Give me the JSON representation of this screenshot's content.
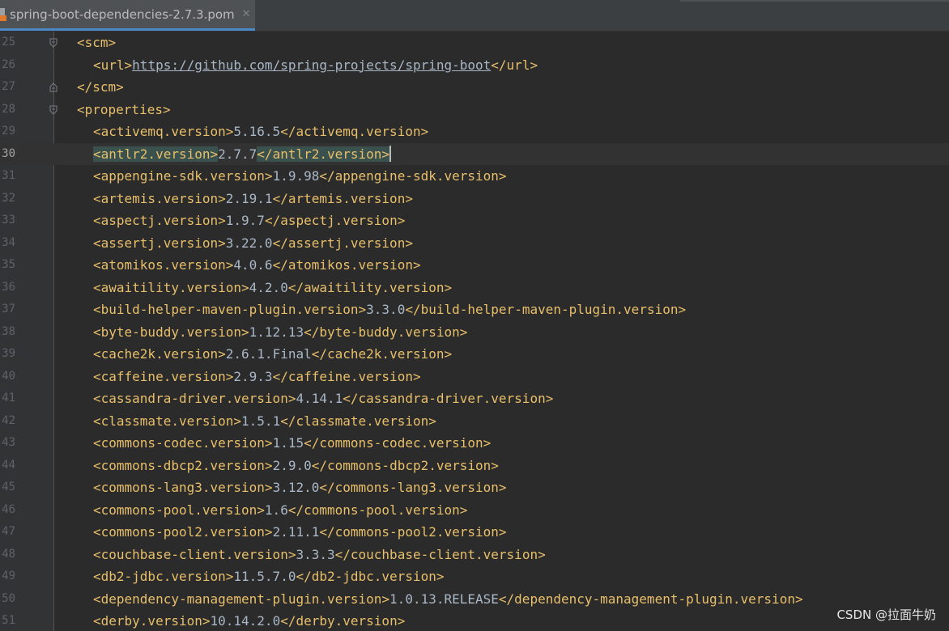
{
  "tab": {
    "title": "spring-boot-dependencies-2.7.3.pom",
    "close_glyph": "✕",
    "icon": "maven-pom-file-icon"
  },
  "editor": {
    "lines": [
      {
        "n": "25",
        "indent": 1,
        "open": "<scm>",
        "value": "",
        "close": "",
        "fold": "open"
      },
      {
        "n": "26",
        "indent": 2,
        "open": "<url>",
        "value": "https://github.com/spring-projects/spring-boot",
        "close": "</url>",
        "url": true
      },
      {
        "n": "27",
        "indent": 1,
        "open": "</scm>",
        "value": "",
        "close": "",
        "fold": "close"
      },
      {
        "n": "28",
        "indent": 1,
        "open": "<properties>",
        "value": "",
        "close": "",
        "fold": "open"
      },
      {
        "n": "29",
        "indent": 2,
        "open": "<activemq.version>",
        "value": "5.16.5",
        "close": "</activemq.version>"
      },
      {
        "n": "30",
        "indent": 2,
        "open": "<antlr2.version>",
        "value": "2.7.7",
        "close": "</antlr2.version>",
        "current": true
      },
      {
        "n": "31",
        "indent": 2,
        "open": "<appengine-sdk.version>",
        "value": "1.9.98",
        "close": "</appengine-sdk.version>"
      },
      {
        "n": "32",
        "indent": 2,
        "open": "<artemis.version>",
        "value": "2.19.1",
        "close": "</artemis.version>"
      },
      {
        "n": "33",
        "indent": 2,
        "open": "<aspectj.version>",
        "value": "1.9.7",
        "close": "</aspectj.version>"
      },
      {
        "n": "34",
        "indent": 2,
        "open": "<assertj.version>",
        "value": "3.22.0",
        "close": "</assertj.version>"
      },
      {
        "n": "35",
        "indent": 2,
        "open": "<atomikos.version>",
        "value": "4.0.6",
        "close": "</atomikos.version>"
      },
      {
        "n": "36",
        "indent": 2,
        "open": "<awaitility.version>",
        "value": "4.2.0",
        "close": "</awaitility.version>"
      },
      {
        "n": "37",
        "indent": 2,
        "open": "<build-helper-maven-plugin.version>",
        "value": "3.3.0",
        "close": "</build-helper-maven-plugin.version>"
      },
      {
        "n": "38",
        "indent": 2,
        "open": "<byte-buddy.version>",
        "value": "1.12.13",
        "close": "</byte-buddy.version>"
      },
      {
        "n": "39",
        "indent": 2,
        "open": "<cache2k.version>",
        "value": "2.6.1.Final",
        "close": "</cache2k.version>"
      },
      {
        "n": "40",
        "indent": 2,
        "open": "<caffeine.version>",
        "value": "2.9.3",
        "close": "</caffeine.version>"
      },
      {
        "n": "41",
        "indent": 2,
        "open": "<cassandra-driver.version>",
        "value": "4.14.1",
        "close": "</cassandra-driver.version>"
      },
      {
        "n": "42",
        "indent": 2,
        "open": "<classmate.version>",
        "value": "1.5.1",
        "close": "</classmate.version>"
      },
      {
        "n": "43",
        "indent": 2,
        "open": "<commons-codec.version>",
        "value": "1.15",
        "close": "</commons-codec.version>"
      },
      {
        "n": "44",
        "indent": 2,
        "open": "<commons-dbcp2.version>",
        "value": "2.9.0",
        "close": "</commons-dbcp2.version>"
      },
      {
        "n": "45",
        "indent": 2,
        "open": "<commons-lang3.version>",
        "value": "3.12.0",
        "close": "</commons-lang3.version>"
      },
      {
        "n": "46",
        "indent": 2,
        "open": "<commons-pool.version>",
        "value": "1.6",
        "close": "</commons-pool.version>"
      },
      {
        "n": "47",
        "indent": 2,
        "open": "<commons-pool2.version>",
        "value": "2.11.1",
        "close": "</commons-pool2.version>"
      },
      {
        "n": "48",
        "indent": 2,
        "open": "<couchbase-client.version>",
        "value": "3.3.3",
        "close": "</couchbase-client.version>"
      },
      {
        "n": "49",
        "indent": 2,
        "open": "<db2-jdbc.version>",
        "value": "11.5.7.0",
        "close": "</db2-jdbc.version>"
      },
      {
        "n": "50",
        "indent": 2,
        "open": "<dependency-management-plugin.version>",
        "value": "1.0.13.RELEASE",
        "close": "</dependency-management-plugin.version>"
      },
      {
        "n": "51",
        "indent": 2,
        "open": "<derby.version>",
        "value": "10.14.2.0",
        "close": "</derby.version>"
      }
    ]
  },
  "watermark": {
    "text": "CSDN @拉面牛奶"
  },
  "colors": {
    "background": "#2b2b2b",
    "tag": "#e8bf6a",
    "text": "#a9b7c6",
    "gutter": "#313335",
    "tab_active_underline": "#4a88c7"
  }
}
